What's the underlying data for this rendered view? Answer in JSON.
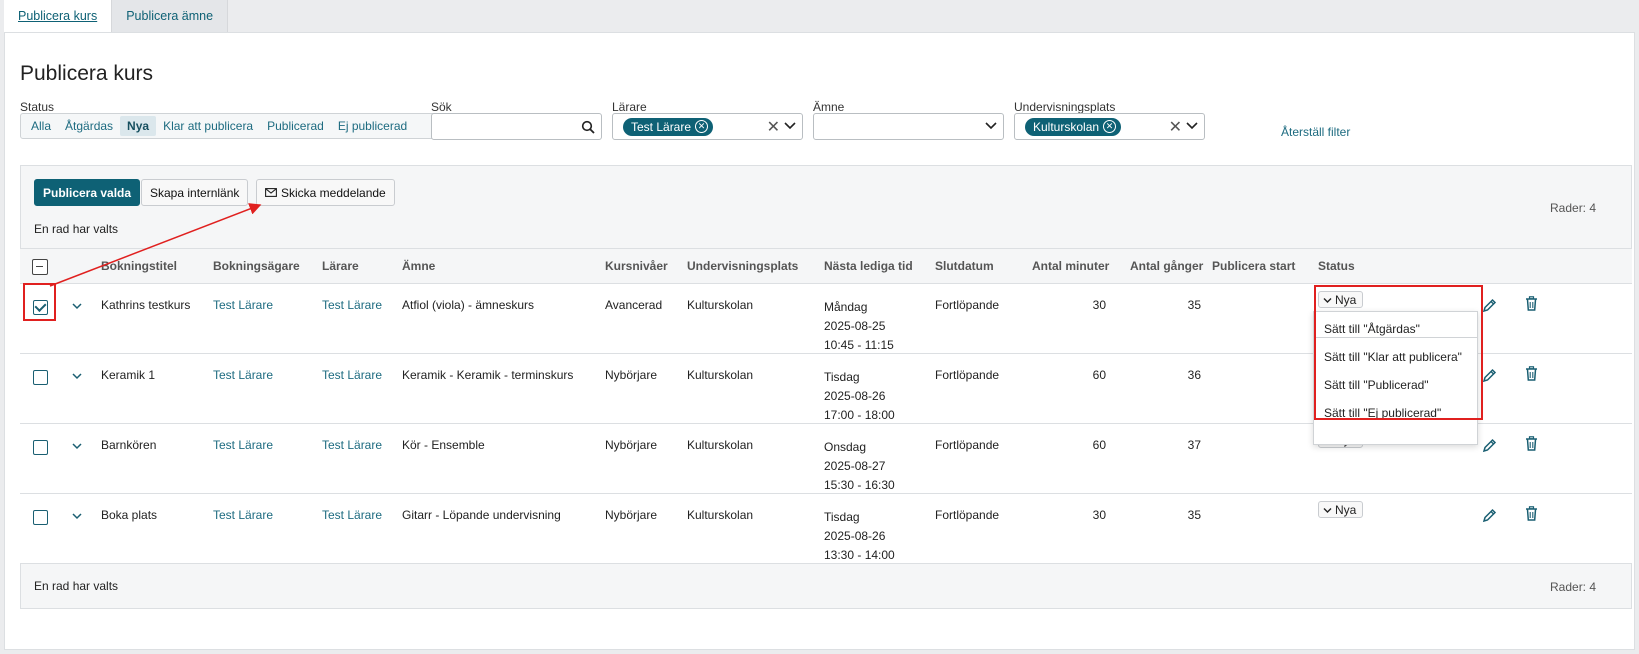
{
  "tabs": [
    {
      "label": "Publicera kurs",
      "active": true
    },
    {
      "label": "Publicera ämne",
      "active": false
    }
  ],
  "page": {
    "title": "Publicera kurs"
  },
  "filters": {
    "status_label": "Status",
    "status_options": [
      "Alla",
      "Åtgärdas",
      "Nya",
      "Klar att publicera",
      "Publicerad",
      "Ej publicerad"
    ],
    "status_active": "Nya",
    "search_label": "Sök",
    "search_value": "",
    "teacher_label": "Lärare",
    "teacher_chip": "Test Lärare",
    "subject_label": "Ämne",
    "place_label": "Undervisningsplats",
    "place_chip": "Kulturskolan",
    "reset_label": "Återställ filter"
  },
  "toolbar": {
    "publish_label": "Publicera valda",
    "internal_link_label": "Skapa internlänk",
    "send_message_label": "Skicka meddelande"
  },
  "selection_info": "En rad har valts",
  "rows_info": "Rader: 4",
  "columns": [
    "Bokningstitel",
    "Bokningsägare",
    "Lärare",
    "Ämne",
    "Kursnivåer",
    "Undervisningsplats",
    "Nästa lediga tid",
    "Slutdatum",
    "Antal minuter",
    "Antal gånger",
    "Publicera start",
    "Status"
  ],
  "rows": [
    {
      "checked": true,
      "title": "Kathrins testkurs",
      "owner": "Test Lärare",
      "teacher": "Test Lärare",
      "subject": "Atfiol (viola) - ämneskurs",
      "level": "Avancerad",
      "place": "Kulturskolan",
      "day": "Måndag",
      "date": "2025-08-25",
      "time": "10:45 - 11:15",
      "end": "Fortlöpande",
      "minutes": "30",
      "times": "35",
      "publish_start": "",
      "status": "Nya"
    },
    {
      "checked": false,
      "title": "Keramik 1",
      "owner": "Test Lärare",
      "teacher": "Test Lärare",
      "subject": "Keramik - Keramik - terminskurs",
      "level": "Nybörjare",
      "place": "Kulturskolan",
      "day": "Tisdag",
      "date": "2025-08-26",
      "time": "17:00 - 18:00",
      "end": "Fortlöpande",
      "minutes": "60",
      "times": "36",
      "publish_start": "",
      "status": "Nya"
    },
    {
      "checked": false,
      "title": "Barnkören",
      "owner": "Test Lärare",
      "teacher": "Test Lärare",
      "subject": "Kör - Ensemble",
      "level": "Nybörjare",
      "place": "Kulturskolan",
      "day": "Onsdag",
      "date": "2025-08-27",
      "time": "15:30 - 16:30",
      "end": "Fortlöpande",
      "minutes": "60",
      "times": "37",
      "publish_start": "",
      "status": "Nya"
    },
    {
      "checked": false,
      "title": "Boka plats",
      "owner": "Test Lärare",
      "teacher": "Test Lärare",
      "subject": "Gitarr - Löpande undervisning",
      "level": "Nybörjare",
      "place": "Kulturskolan",
      "day": "Tisdag",
      "date": "2025-08-26",
      "time": "13:30 - 14:00",
      "end": "Fortlöpande",
      "minutes": "30",
      "times": "35",
      "publish_start": "",
      "status": "Nya"
    }
  ],
  "status_menu": [
    "Sätt till \"Åtgärdas\"",
    "Sätt till \"Klar att publicera\"",
    "Sätt till \"Publicerad\"",
    "Sätt till \"Ej publicerad\""
  ],
  "colors": {
    "accent": "#0e6175",
    "link": "#1d6b80",
    "highlight": "#e0201f"
  },
  "icons": [
    "search-icon",
    "chevron-down-icon",
    "clear-icon",
    "mail-icon",
    "edit-icon",
    "trash-icon"
  ]
}
